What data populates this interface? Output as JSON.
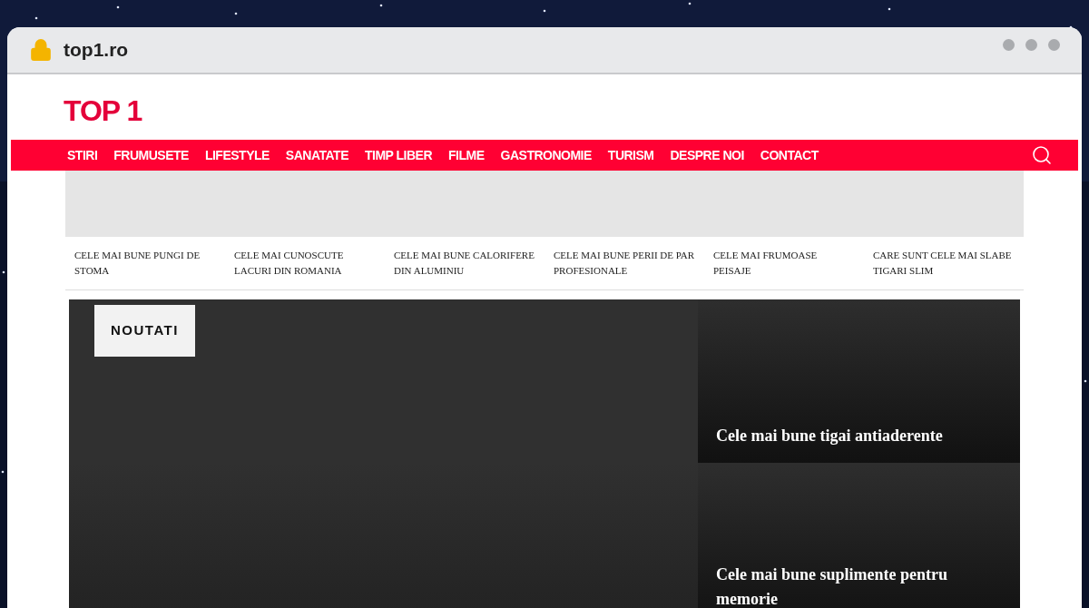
{
  "browser": {
    "url": "top1.ro"
  },
  "site": {
    "logo": "TOP 1"
  },
  "nav": {
    "items": [
      {
        "label": "STIRI"
      },
      {
        "label": "FRUMUSETE"
      },
      {
        "label": "LIFESTYLE"
      },
      {
        "label": "SANATATE"
      },
      {
        "label": "TIMP LIBER"
      },
      {
        "label": "FILME"
      },
      {
        "label": "GASTRONOMIE"
      },
      {
        "label": "TURISM"
      },
      {
        "label": "DESPRE NOI"
      },
      {
        "label": "CONTACT"
      }
    ]
  },
  "articles": [
    "CELE MAI BUNE PUNGI DE STOMA",
    "CELE MAI CUNOSCUTE LACURI DIN ROMANIA",
    "CELE MAI BUNE CALORIFERE DIN ALUMINIU",
    "CELE MAI BUNE PERII DE PAR PROFESIONALE",
    "CELE MAI FRUMOASE PEISAJE",
    "CARE SUNT CELE MAI SLABE TIGARI SLIM"
  ],
  "featured": {
    "badge": "NOUTATI",
    "side_cards": [
      {
        "title": "Cele mai bune tigai antiaderente"
      },
      {
        "title": "Cele mai bune suplimente pentru memorie"
      }
    ]
  }
}
